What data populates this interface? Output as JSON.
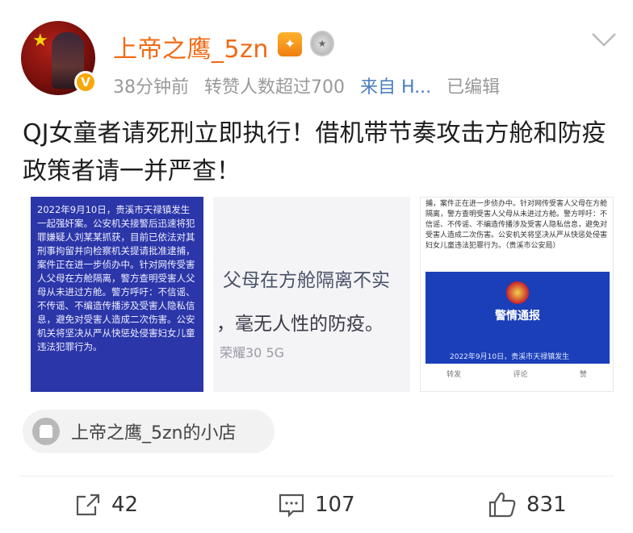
{
  "user": {
    "name": "上帝之鹰_5zn",
    "verified_badge": "V"
  },
  "meta": {
    "time": "38分钟前",
    "reposts_note": "转赞人数超过700",
    "source": "来自 H...",
    "edited": "已编辑"
  },
  "post": {
    "text": "QJ女童者请死刑立即执行！借机带节奏攻击方舱和防疫政策者请一并严查！"
  },
  "images": {
    "img1_text": "2022年9月10日，贵溪市天禄镇发生一起强奸案。公安机关接警后迅速将犯罪嫌疑人刘某某抓获，目前已依法对其刑事拘留并向检察机关提请批准逮捕，案件正在进一步侦办中。针对网传受害人父母在方舱隔离，警方查明受害人父母从未进过方舱。警方呼吁：不信谣、不传谣、不编造传播涉及受害人隐私信息，避免对受害人造成二次伤害。公安机关将坚决从严从快惩处侵害妇女儿童违法犯罪行为。",
    "img2_line1": "父母在方舱隔离不实",
    "img2_line2": "，毫无人性的防疫。",
    "img2_phone": "荣耀30 5G",
    "img3_text": "捕，案件正在进一步侦办中。针对网传受害人父母在方舱隔离，警方查明受害人父母从未进过方舱。警方呼吁：不信谣、不传谣、不编造传播涉及受害人隐私信息，避免对受害人造成二次伤害。公安机关将坚决从严从快惩处侵害妇女儿童违法犯罪行为。（贵溪市公安局）",
    "img3_banner_title": "警情通报",
    "img3_banner_date": "2022年9月10日，贵溪市天禄镇发生",
    "img3_repost": "转发",
    "img3_comment": "评论",
    "img3_like": "赞"
  },
  "shop": {
    "label": "上帝之鹰_5zn的小店"
  },
  "actions": {
    "repost_count": "42",
    "comment_count": "107",
    "like_count": "831"
  },
  "colors": {
    "username": "#f06a14",
    "source_link": "#4a7fc1",
    "meta": "#999999",
    "notice_blue": "#2b36a8"
  }
}
